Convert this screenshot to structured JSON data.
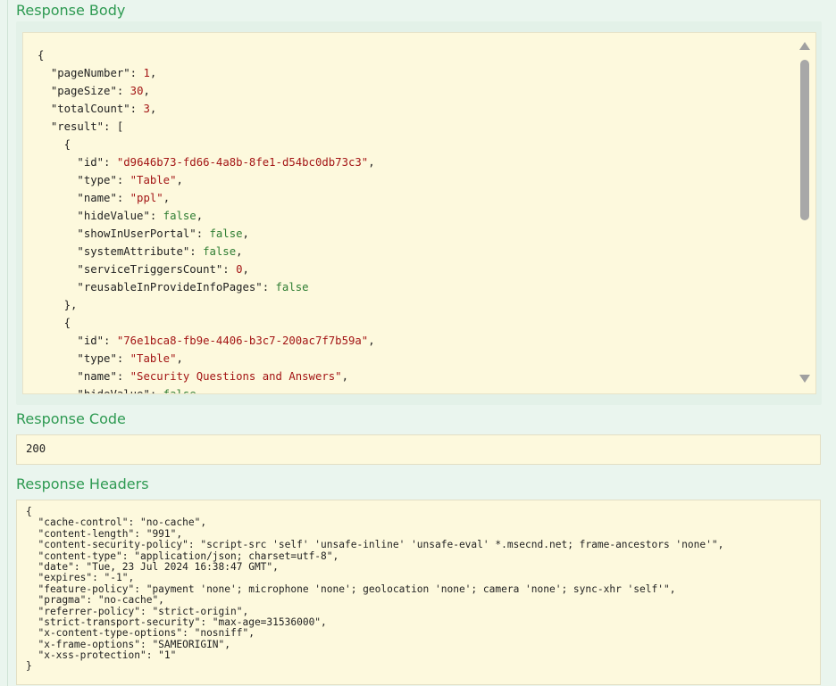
{
  "sections": {
    "body_title": "Response Body",
    "code_title": "Response Code",
    "headers_title": "Response Headers"
  },
  "response_code": "200",
  "body_lines": [
    [
      [
        "p",
        "{"
      ]
    ],
    [
      [
        "p",
        "  "
      ],
      [
        "k",
        "\"pageNumber\""
      ],
      [
        "p",
        ": "
      ],
      [
        "n",
        "1"
      ],
      [
        "p",
        ","
      ]
    ],
    [
      [
        "p",
        "  "
      ],
      [
        "k",
        "\"pageSize\""
      ],
      [
        "p",
        ": "
      ],
      [
        "n",
        "30"
      ],
      [
        "p",
        ","
      ]
    ],
    [
      [
        "p",
        "  "
      ],
      [
        "k",
        "\"totalCount\""
      ],
      [
        "p",
        ": "
      ],
      [
        "n",
        "3"
      ],
      [
        "p",
        ","
      ]
    ],
    [
      [
        "p",
        "  "
      ],
      [
        "k",
        "\"result\""
      ],
      [
        "p",
        ": ["
      ]
    ],
    [
      [
        "p",
        "    {"
      ]
    ],
    [
      [
        "p",
        "      "
      ],
      [
        "k",
        "\"id\""
      ],
      [
        "p",
        ": "
      ],
      [
        "s",
        "\"d9646b73-fd66-4a8b-8fe1-d54bc0db73c3\""
      ],
      [
        "p",
        ","
      ]
    ],
    [
      [
        "p",
        "      "
      ],
      [
        "k",
        "\"type\""
      ],
      [
        "p",
        ": "
      ],
      [
        "s",
        "\"Table\""
      ],
      [
        "p",
        ","
      ]
    ],
    [
      [
        "p",
        "      "
      ],
      [
        "k",
        "\"name\""
      ],
      [
        "p",
        ": "
      ],
      [
        "s",
        "\"ppl\""
      ],
      [
        "p",
        ","
      ]
    ],
    [
      [
        "p",
        "      "
      ],
      [
        "k",
        "\"hideValue\""
      ],
      [
        "p",
        ": "
      ],
      [
        "b",
        "false"
      ],
      [
        "p",
        ","
      ]
    ],
    [
      [
        "p",
        "      "
      ],
      [
        "k",
        "\"showInUserPortal\""
      ],
      [
        "p",
        ": "
      ],
      [
        "b",
        "false"
      ],
      [
        "p",
        ","
      ]
    ],
    [
      [
        "p",
        "      "
      ],
      [
        "k",
        "\"systemAttribute\""
      ],
      [
        "p",
        ": "
      ],
      [
        "b",
        "false"
      ],
      [
        "p",
        ","
      ]
    ],
    [
      [
        "p",
        "      "
      ],
      [
        "k",
        "\"serviceTriggersCount\""
      ],
      [
        "p",
        ": "
      ],
      [
        "n",
        "0"
      ],
      [
        "p",
        ","
      ]
    ],
    [
      [
        "p",
        "      "
      ],
      [
        "k",
        "\"reusableInProvideInfoPages\""
      ],
      [
        "p",
        ": "
      ],
      [
        "b",
        "false"
      ]
    ],
    [
      [
        "p",
        "    },"
      ]
    ],
    [
      [
        "p",
        "    {"
      ]
    ],
    [
      [
        "p",
        "      "
      ],
      [
        "k",
        "\"id\""
      ],
      [
        "p",
        ": "
      ],
      [
        "s",
        "\"76e1bca8-fb9e-4406-b3c7-200ac7f7b59a\""
      ],
      [
        "p",
        ","
      ]
    ],
    [
      [
        "p",
        "      "
      ],
      [
        "k",
        "\"type\""
      ],
      [
        "p",
        ": "
      ],
      [
        "s",
        "\"Table\""
      ],
      [
        "p",
        ","
      ]
    ],
    [
      [
        "p",
        "      "
      ],
      [
        "k",
        "\"name\""
      ],
      [
        "p",
        ": "
      ],
      [
        "s",
        "\"Security Questions and Answers\""
      ],
      [
        "p",
        ","
      ]
    ],
    [
      [
        "p",
        "      "
      ],
      [
        "k",
        "\"hideValue\""
      ],
      [
        "p",
        ": "
      ],
      [
        "b",
        "false"
      ],
      [
        "p",
        ","
      ]
    ]
  ],
  "header_lines": [
    "{",
    "  \"cache-control\": \"no-cache\",",
    "  \"content-length\": \"991\",",
    "  \"content-security-policy\": \"script-src 'self' 'unsafe-inline' 'unsafe-eval' *.msecnd.net; frame-ancestors 'none'\",",
    "  \"content-type\": \"application/json; charset=utf-8\",",
    "  \"date\": \"Tue, 23 Jul 2024 16:38:47 GMT\",",
    "  \"expires\": \"-1\",",
    "  \"feature-policy\": \"payment 'none'; microphone 'none'; geolocation 'none'; camera 'none'; sync-xhr 'self'\",",
    "  \"pragma\": \"no-cache\",",
    "  \"referrer-policy\": \"strict-origin\",",
    "  \"strict-transport-security\": \"max-age=31536000\",",
    "  \"x-content-type-options\": \"nosniff\",",
    "  \"x-frame-options\": \"SAMEORIGIN\",",
    "  \"x-xss-protection\": \"1\"",
    "}"
  ],
  "colors": {
    "heading": "#2e9a52",
    "panel_bg": "#fdf9dd",
    "page_bg": "#eaf5ee",
    "string": "#a31515",
    "boolean": "#2e7d32"
  },
  "icons": {
    "scroll_up": "triangle-up",
    "scroll_down": "triangle-down"
  }
}
